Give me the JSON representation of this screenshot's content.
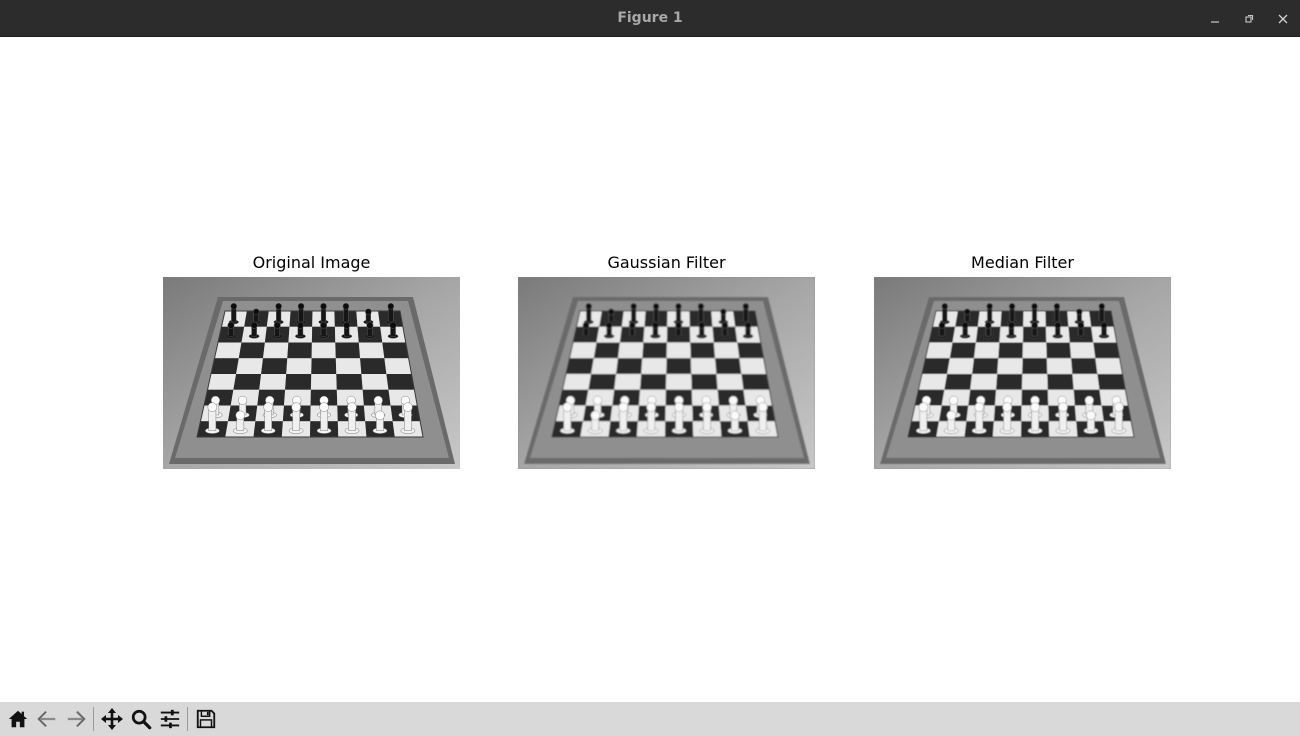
{
  "window": {
    "title": "Figure 1",
    "controls": [
      {
        "name": "minimize-button",
        "icon": "minimize-icon"
      },
      {
        "name": "maximize-button",
        "icon": "maximize-icon"
      },
      {
        "name": "close-button",
        "icon": "close-icon"
      }
    ]
  },
  "figure": {
    "subplots": [
      {
        "title": "Original Image",
        "image": "chessboard-grayscale",
        "filter": "none"
      },
      {
        "title": "Gaussian Filter",
        "image": "chessboard-grayscale",
        "filter": "blur"
      },
      {
        "title": "Median Filter",
        "image": "chessboard-grayscale",
        "filter": "soft"
      }
    ]
  },
  "toolbar": {
    "buttons": [
      {
        "name": "home-button",
        "icon": "home-icon"
      },
      {
        "name": "back-button",
        "icon": "back-arrow-icon"
      },
      {
        "name": "forward-button",
        "icon": "forward-arrow-icon"
      },
      {
        "name": "pan-button",
        "icon": "move-icon"
      },
      {
        "name": "zoom-button",
        "icon": "magnifier-icon"
      },
      {
        "name": "configure-subplots-button",
        "icon": "sliders-icon"
      },
      {
        "name": "save-button",
        "icon": "floppy-disk-icon"
      }
    ]
  },
  "colors": {
    "titlebar_bg": "#2c2c2c",
    "toolbar_bg": "#d9d9d9",
    "canvas_bg": "#ffffff"
  }
}
